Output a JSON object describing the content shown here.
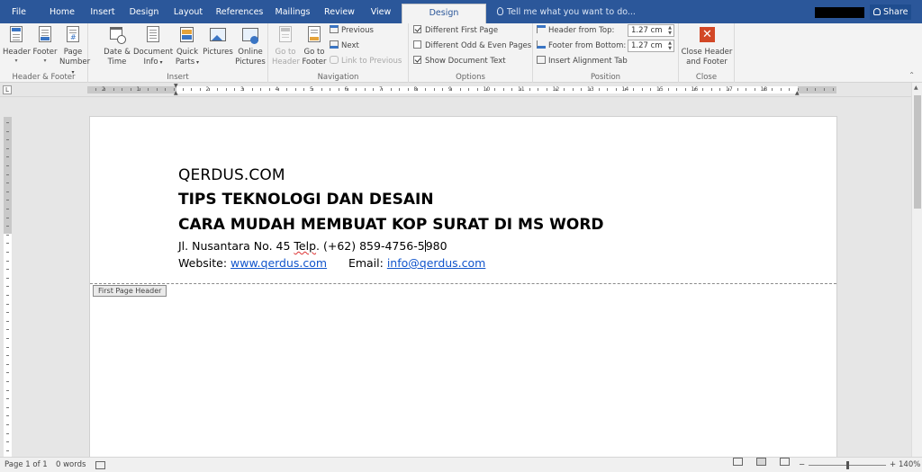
{
  "tabs": [
    {
      "label": "File"
    },
    {
      "label": "Home"
    },
    {
      "label": "Insert"
    },
    {
      "label": "Design"
    },
    {
      "label": "Layout"
    },
    {
      "label": "References"
    },
    {
      "label": "Mailings"
    },
    {
      "label": "Review"
    },
    {
      "label": "View"
    },
    {
      "label": "Design",
      "active": true
    }
  ],
  "tell_me": "Tell me what you want to do...",
  "share": "Share",
  "ribbon": {
    "header_footer": {
      "label": "Header & Footer",
      "header": "Header",
      "footer": "Footer",
      "page_number_1": "Page",
      "page_number_2": "Number"
    },
    "insert": {
      "label": "Insert",
      "date_time_1": "Date &",
      "date_time_2": "Time",
      "doc_info_1": "Document",
      "doc_info_2": "Info",
      "quick_parts_1": "Quick",
      "quick_parts_2": "Parts",
      "pictures": "Pictures",
      "online_pictures_1": "Online",
      "online_pictures_2": "Pictures"
    },
    "navigation": {
      "label": "Navigation",
      "goto_header_1": "Go to",
      "goto_header_2": "Header",
      "goto_footer_1": "Go to",
      "goto_footer_2": "Footer",
      "previous": "Previous",
      "next": "Next",
      "link_previous": "Link to Previous"
    },
    "options": {
      "label": "Options",
      "different_first_page": "Different First Page",
      "different_odd_even": "Different Odd & Even Pages",
      "show_document_text": "Show Document Text",
      "different_first_page_checked": true,
      "different_odd_even_checked": false,
      "show_document_text_checked": true
    },
    "position": {
      "label": "Position",
      "header_from_top": "Header from Top:",
      "header_from_top_value": "1.27 cm",
      "footer_from_bottom": "Footer from Bottom:",
      "footer_from_bottom_value": "1.27 cm",
      "insert_alignment_tab": "Insert Alignment Tab"
    },
    "close": {
      "label": "Close",
      "close_1": "Close Header",
      "close_2": "and Footer"
    }
  },
  "ruler": {
    "tab_selector": "L",
    "numbers": [
      "2",
      "1",
      "1",
      "2",
      "3",
      "4",
      "5",
      "6",
      "7",
      "8",
      "9",
      "10",
      "11",
      "12",
      "13",
      "14",
      "15",
      "16",
      "17",
      "18"
    ]
  },
  "document": {
    "line1": "QERDUS.COM",
    "line2": "TIPS TEKNOLOGI DAN DESAIN",
    "line3": "CARA MUDAH MEMBUAT KOP SURAT DI MS WORD",
    "line4_a": "Jl. Nusantara No. 45 ",
    "line4_b": "Telp",
    "line4_c": ". (+62) 859-4756-5",
    "line4_d": "980",
    "line5_a": "Website: ",
    "line5_link1": "www.qerdus.com",
    "line5_b": "      Email: ",
    "line5_link2": "info@qerdus.com",
    "header_tag": "First Page Header"
  },
  "status": {
    "page": "Page 1 of 1",
    "words": "0 words",
    "zoom": "140%",
    "zoom_minus": "−",
    "zoom_plus": "+"
  }
}
